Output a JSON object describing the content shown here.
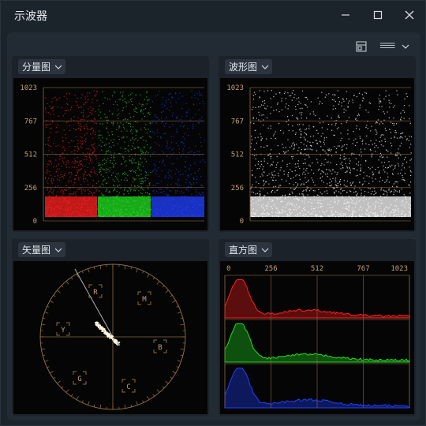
{
  "window": {
    "title": "示波器"
  },
  "toolbar": {
    "display_label": "☰☰☰"
  },
  "panels": {
    "parade": {
      "label": "分量图",
      "ticks": [
        "1023",
        "767",
        "512",
        "256",
        "0"
      ]
    },
    "waveform": {
      "label": "波形图",
      "ticks": [
        "1023",
        "767",
        "512",
        "256",
        "0"
      ]
    },
    "vectorscope": {
      "label": "矢量图",
      "targets": [
        "R",
        "M",
        "Y",
        "B",
        "G",
        "C"
      ]
    },
    "histogram": {
      "label": "直方图",
      "ticks": [
        "0",
        "256",
        "512",
        "767",
        "1023"
      ]
    }
  },
  "colors": {
    "red": "#ff2020",
    "green": "#20e020",
    "blue": "#2040ff",
    "graticule": "#8a6a44",
    "tick_text": "#c5a070"
  }
}
